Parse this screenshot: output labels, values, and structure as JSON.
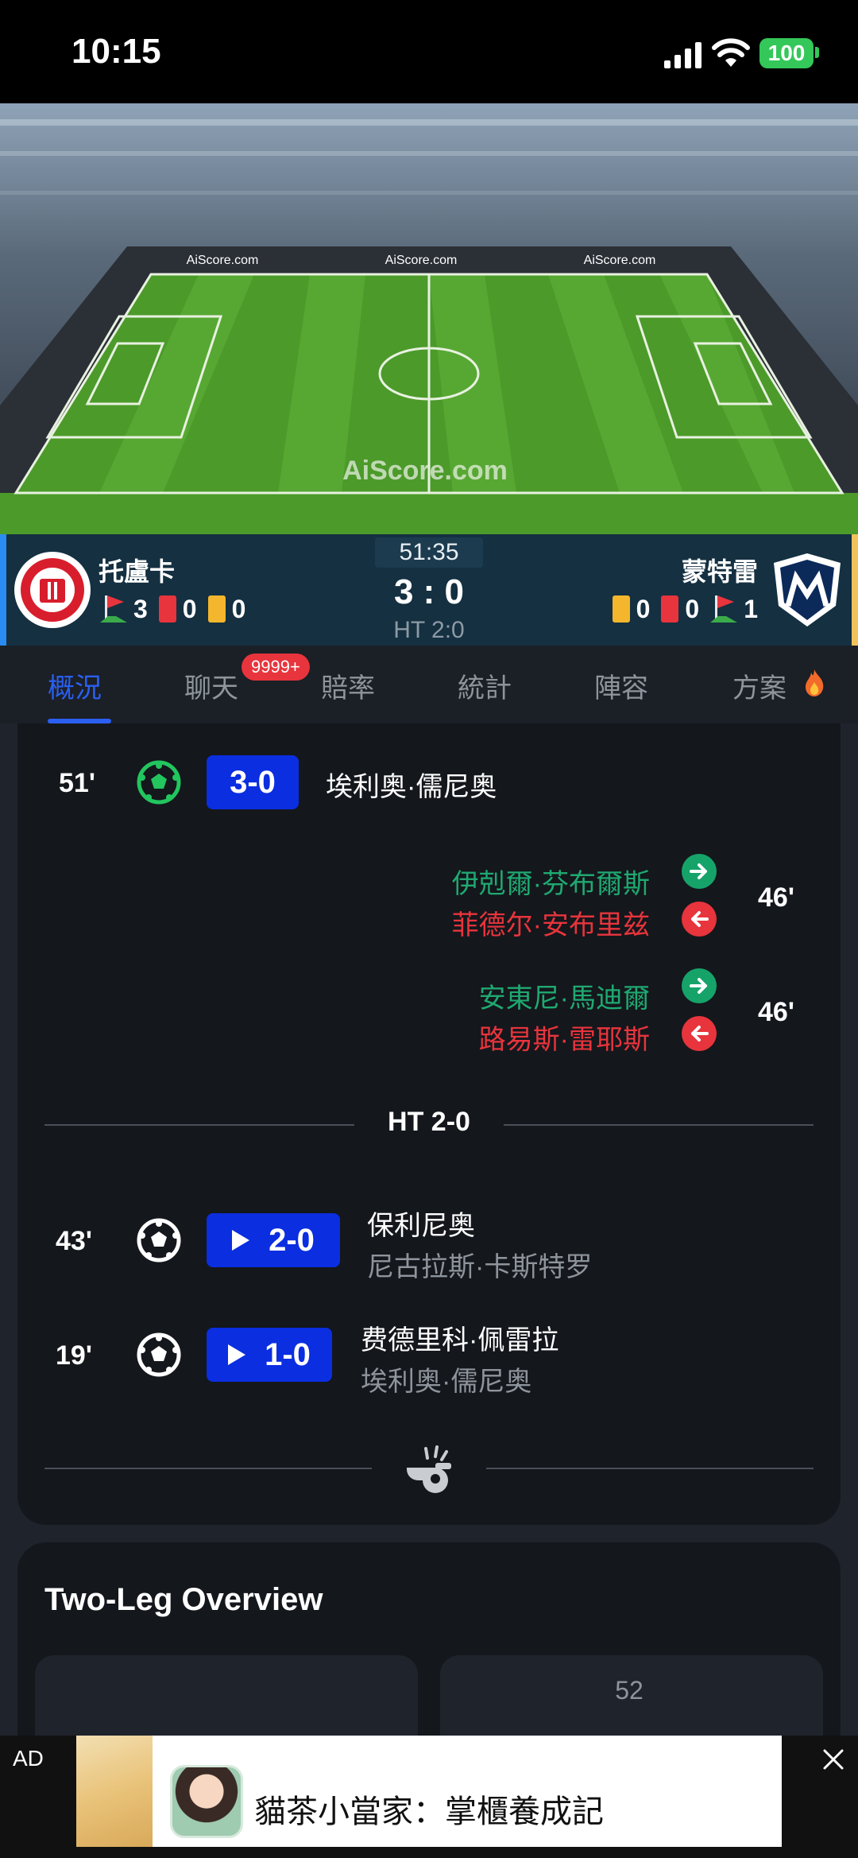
{
  "status_bar": {
    "time": "10:15",
    "battery": "100"
  },
  "stadium": {
    "watermark": "AiScore.com"
  },
  "match": {
    "clock": "51:35",
    "score": "3 : 0",
    "halftime": "HT 2:0",
    "home": {
      "name": "托盧卡",
      "corners": "3",
      "red_cards": "0",
      "yellow_cards": "0"
    },
    "away": {
      "name": "蒙特雷",
      "corners": "1",
      "red_cards": "0",
      "yellow_cards": "0"
    }
  },
  "tabs": [
    {
      "label": "概況",
      "active": true
    },
    {
      "label": "聊天",
      "badge": "9999+"
    },
    {
      "label": "賠率"
    },
    {
      "label": "統計"
    },
    {
      "label": "陣容"
    },
    {
      "label": "方案"
    }
  ],
  "events": {
    "goal_51": {
      "minute": "51'",
      "score": "3-0",
      "player": "埃利奥·儒尼奥"
    },
    "sub_1": {
      "minute": "46'",
      "in": "伊剋爾·芬布爾斯",
      "out": "菲德尔·安布里兹"
    },
    "sub_2": {
      "minute": "46'",
      "in": "安東尼·馬迪爾",
      "out": "路易斯·雷耶斯"
    },
    "ht_label": "HT 2-0",
    "goal_43": {
      "minute": "43'",
      "score": "2-0",
      "player": "保利尼奥",
      "assist": "尼古拉斯·卡斯特罗"
    },
    "goal_19": {
      "minute": "19'",
      "score": "1-0",
      "player": "费德里科·佩雷拉",
      "assist": "埃利奥·儒尼奥"
    }
  },
  "overview": {
    "title": "Two-Leg Overview",
    "leg2_number": "52"
  },
  "ad": {
    "label": "AD",
    "text": "貓茶小當家：掌櫃養成記"
  },
  "colors": {
    "accent": "#2a5ff0",
    "score_chip": "#0a2ee0",
    "sub_in": "#1fa971",
    "sub_out": "#e8343c",
    "pitch": "#4c9a2a"
  }
}
